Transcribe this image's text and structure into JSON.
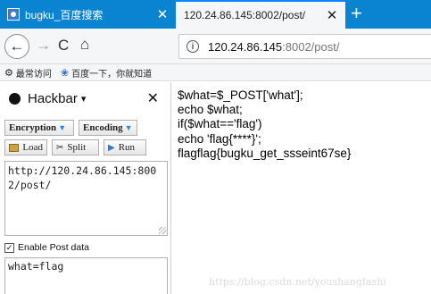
{
  "tabs": [
    {
      "title": "bugku_百度搜索",
      "close": "✕"
    },
    {
      "title": "120.24.86.145:8002/post/",
      "close": "✕"
    }
  ],
  "new_tab": "+",
  "nav": {
    "back": "←",
    "forward": "→",
    "reload": "C",
    "home": "⌂",
    "url_info": "i",
    "url_host": "120.24.86.145",
    "url_rest": ":8002/post/"
  },
  "bookmarks": [
    {
      "icon": "gear-icon",
      "label": "最常访问"
    },
    {
      "icon": "paw-icon",
      "label": "百度一下，你就知道"
    }
  ],
  "hackbar": {
    "title": "Hackbar",
    "close": "✕",
    "encryption_label": "Encryption",
    "encoding_label": "Encoding",
    "load_label": "Load",
    "split_label": "Split",
    "run_label": "Run",
    "url_value": "http://120.24.86.145:8002/post/",
    "enable_post_label": "Enable Post data",
    "enable_post_checked": true,
    "post_value": "what=flag"
  },
  "page": {
    "lines": [
      "$what=$_POST['what'];",
      "echo $what;",
      "if($what=='flag')",
      "echo 'flag{****}';",
      "flagflag{bugku_get_ssseint67se}"
    ]
  },
  "watermark": "https://blog.csdn.net/youshangfashi",
  "colors": {
    "tabstrip": "#0a84d0",
    "toolbar": "#f5f6f7",
    "accent": "#0a84ff"
  }
}
